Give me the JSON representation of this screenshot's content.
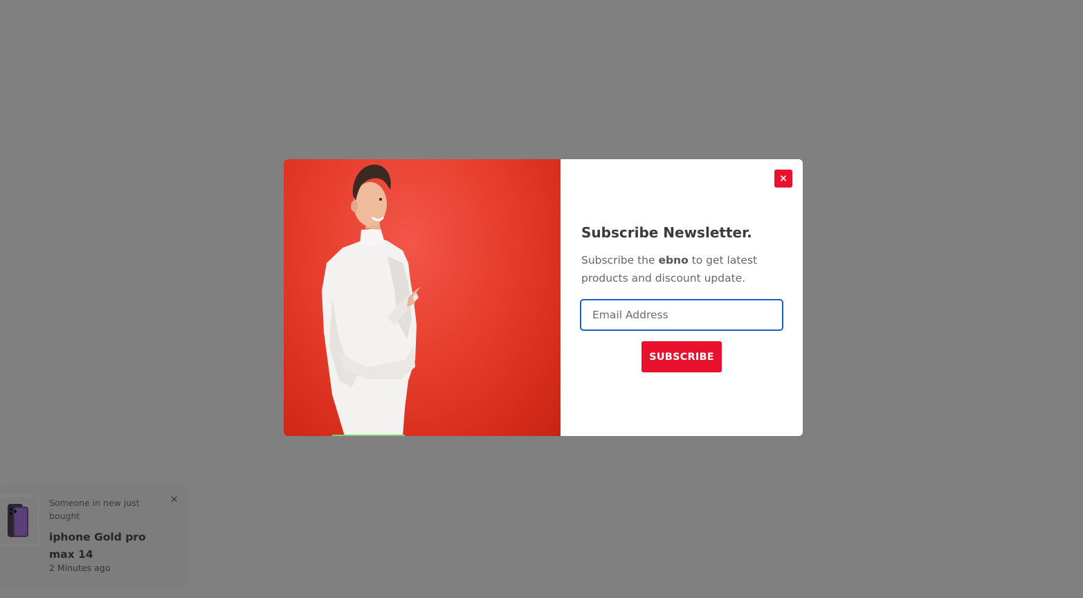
{
  "modal": {
    "close_label": "×",
    "title": "Subscribe Newsletter.",
    "description_prefix": "Subscribe the ",
    "brand": "ebno",
    "description_suffix": " to get latest products and discount update.",
    "email_placeholder": "Email Address",
    "email_value": "",
    "subscribe_label": "SUBSCRIBE",
    "image_icon": "man-pointing-image"
  },
  "toast": {
    "close_label": "×",
    "prefix": "Someone in new just bought",
    "product": "iphone Gold pro max 14",
    "time": "2 Minutes ago",
    "thumb_icon": "phone-product-image"
  },
  "colors": {
    "overlay": "#808080",
    "accent": "#e8122f",
    "input_border": "#1a5fd1",
    "image_bg": "#e8402f"
  }
}
